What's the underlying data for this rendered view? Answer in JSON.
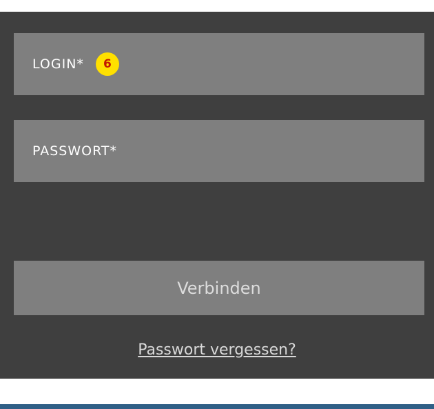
{
  "form": {
    "login_label": "LOGIN*",
    "login_badge": "6",
    "password_label": "PASSWORT*",
    "connect_label": "Verbinden",
    "forgot_label": "Passwort vergessen?"
  },
  "colors": {
    "panel_bg": "#3f3f3f",
    "field_bg": "#7f7f7f",
    "badge_bg": "#ffe000",
    "badge_text": "#c21800",
    "bottom_bar": "#2f5f86"
  }
}
